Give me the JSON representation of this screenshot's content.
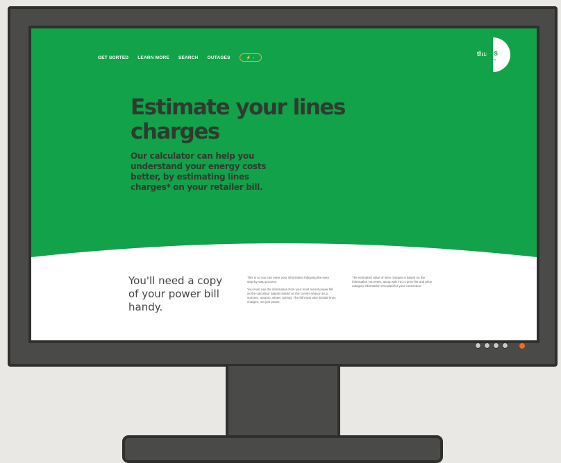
{
  "nav": {
    "items": [
      "GET SORTED",
      "LEARN MORE",
      "SEARCH",
      "OUTAGES"
    ],
    "toggle_icon": "toggle-switch-icon"
  },
  "logo": {
    "prefix": "the",
    "word": "lines",
    "sub": "company"
  },
  "hero": {
    "title": "Estimate your lines charges",
    "subtitle": "Our calculator can help you understand your energy costs better, by estimating lines charges* on your retailer bill."
  },
  "info": {
    "need": "You'll need a copy of your power bill handy.",
    "col1": [
      "This is so you can enter your information following the easy step-by-step process.",
      "You must use the information from your most recent power bill as the calculator adjusts based on the current season (e.g. summer, autumn, winter, spring). The bill must also include lines charges, not just power."
    ],
    "col2": [
      "The estimated value of lines charges is based on the information you enter, along with TLC's price list and price category information recorded for your connection."
    ]
  },
  "colors": {
    "brand_green": "#12a24a",
    "heading": "#2f3b2f",
    "accent_orange": "#f0a542",
    "power_led": "#f26b21"
  }
}
